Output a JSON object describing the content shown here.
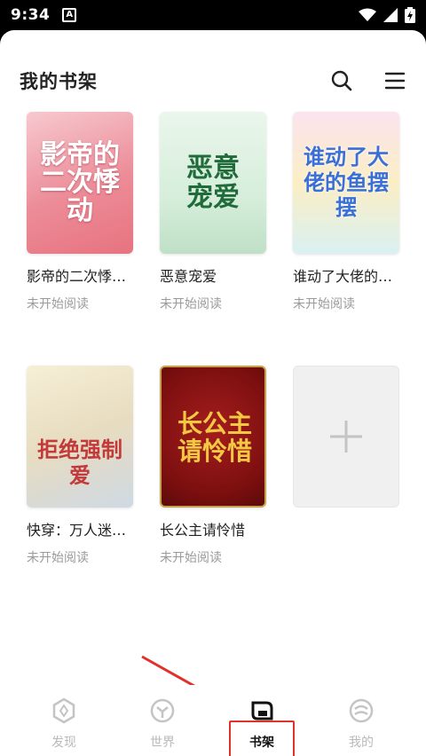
{
  "status_bar": {
    "time": "9:34",
    "notification_letter": "A"
  },
  "header": {
    "title": "我的书架"
  },
  "books": [
    {
      "title": "影帝的二次悸…",
      "status": "未开始阅读",
      "cover_text": "影帝的二次悸动",
      "cover_color": "#f2a0a8"
    },
    {
      "title": "恶意宠爱",
      "status": "未开始阅读",
      "cover_text": "恶意宠爱",
      "cover_color": "#cfe9d2"
    },
    {
      "title": "谁动了大佬的…",
      "status": "未开始阅读",
      "cover_text": "谁动了大佬的鱼摆摆",
      "cover_color": "#fbe6a8"
    },
    {
      "title": "快穿：万人迷…",
      "status": "未开始阅读",
      "cover_text": "拒绝强制爱",
      "cover_color": "#efe6c6"
    },
    {
      "title": "长公主请怜惜",
      "status": "未开始阅读",
      "cover_text": "长公主请怜惜",
      "cover_color": "#8e1414"
    }
  ],
  "bottom_nav": [
    {
      "label": "发现",
      "icon": "discover-icon",
      "active": false
    },
    {
      "label": "世界",
      "icon": "world-icon",
      "active": false
    },
    {
      "label": "书架",
      "icon": "bookshelf-icon",
      "active": true
    },
    {
      "label": "我的",
      "icon": "profile-icon",
      "active": false
    }
  ],
  "colors": {
    "highlight": "#e0312a",
    "inactive_nav": "#b9b9b9",
    "status_text": "#9a9a9a"
  }
}
